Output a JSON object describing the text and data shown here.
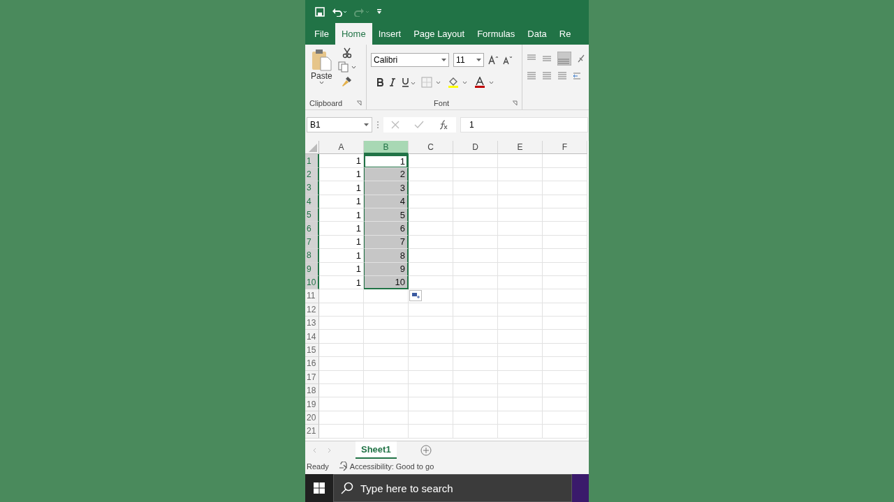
{
  "ribbon_tabs": [
    {
      "label": "File",
      "selected": false
    },
    {
      "label": "Home",
      "selected": true
    },
    {
      "label": "Insert",
      "selected": false
    },
    {
      "label": "Page Layout",
      "selected": false
    },
    {
      "label": "Formulas",
      "selected": false
    },
    {
      "label": "Data",
      "selected": false
    },
    {
      "label": "Re",
      "selected": false
    }
  ],
  "ribbon": {
    "paste_label": "Paste",
    "clipboard_label": "Clipboard",
    "font_name": "Calibri",
    "font_size": "11",
    "font_label": "Font"
  },
  "formula_bar": {
    "name_box": "B1",
    "value": "1"
  },
  "sheet": {
    "columns": [
      {
        "label": "A",
        "selected": false
      },
      {
        "label": "B",
        "selected": true
      },
      {
        "label": "C",
        "selected": false
      },
      {
        "label": "D",
        "selected": false
      },
      {
        "label": "E",
        "selected": false
      },
      {
        "label": "F",
        "selected": false
      }
    ],
    "rows": [
      {
        "label": "1",
        "selected": true,
        "cells": [
          {
            "value": "1",
            "selected": false,
            "active": false
          },
          {
            "value": "1",
            "selected": true,
            "active": true
          }
        ]
      },
      {
        "label": "2",
        "selected": true,
        "cells": [
          {
            "value": "1",
            "selected": false,
            "active": false
          },
          {
            "value": "2",
            "selected": true,
            "active": false
          }
        ]
      },
      {
        "label": "3",
        "selected": true,
        "cells": [
          {
            "value": "1",
            "selected": false,
            "active": false
          },
          {
            "value": "3",
            "selected": true,
            "active": false
          }
        ]
      },
      {
        "label": "4",
        "selected": true,
        "cells": [
          {
            "value": "1",
            "selected": false,
            "active": false
          },
          {
            "value": "4",
            "selected": true,
            "active": false
          }
        ]
      },
      {
        "label": "5",
        "selected": true,
        "cells": [
          {
            "value": "1",
            "selected": false,
            "active": false
          },
          {
            "value": "5",
            "selected": true,
            "active": false
          }
        ]
      },
      {
        "label": "6",
        "selected": true,
        "cells": [
          {
            "value": "1",
            "selected": false,
            "active": false
          },
          {
            "value": "6",
            "selected": true,
            "active": false
          }
        ]
      },
      {
        "label": "7",
        "selected": true,
        "cells": [
          {
            "value": "1",
            "selected": false,
            "active": false
          },
          {
            "value": "7",
            "selected": true,
            "active": false
          }
        ]
      },
      {
        "label": "8",
        "selected": true,
        "cells": [
          {
            "value": "1",
            "selected": false,
            "active": false
          },
          {
            "value": "8",
            "selected": true,
            "active": false
          }
        ]
      },
      {
        "label": "9",
        "selected": true,
        "cells": [
          {
            "value": "1",
            "selected": false,
            "active": false
          },
          {
            "value": "9",
            "selected": true,
            "active": false
          }
        ]
      },
      {
        "label": "10",
        "selected": true,
        "cells": [
          {
            "value": "1",
            "selected": false,
            "active": false
          },
          {
            "value": "10",
            "selected": true,
            "active": false
          }
        ]
      },
      {
        "label": "11",
        "selected": false
      },
      {
        "label": "12",
        "selected": false
      },
      {
        "label": "13",
        "selected": false
      },
      {
        "label": "14",
        "selected": false
      },
      {
        "label": "15",
        "selected": false
      },
      {
        "label": "16",
        "selected": false
      },
      {
        "label": "17",
        "selected": false
      },
      {
        "label": "18",
        "selected": false
      },
      {
        "label": "19",
        "selected": false
      },
      {
        "label": "20",
        "selected": false
      },
      {
        "label": "21",
        "selected": false
      }
    ]
  },
  "sheet_tabs": [
    {
      "label": "Sheet1",
      "selected": true
    }
  ],
  "status_bar": {
    "status": "Ready",
    "accessibility": "Accessibility: Good to go"
  },
  "taskbar": {
    "search_placeholder": "Type here to search"
  }
}
